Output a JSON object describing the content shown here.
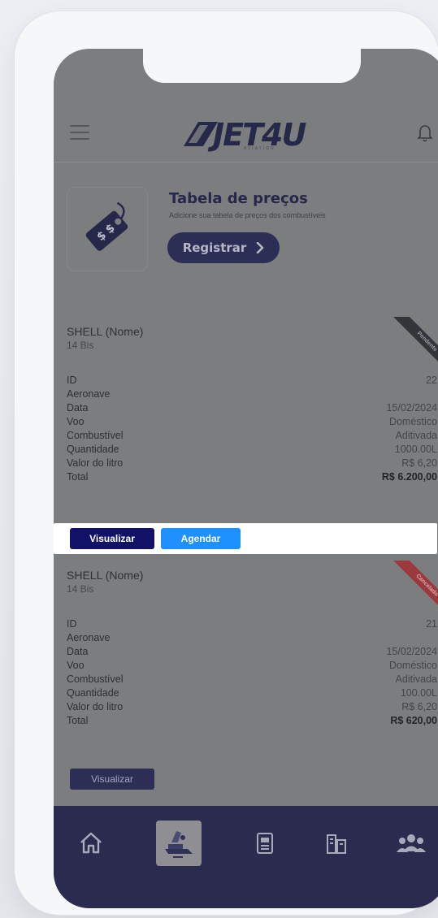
{
  "app": {
    "logo_text": "JET4U",
    "logo_subtitle": "AVIATION"
  },
  "header": {
    "menu_icon": "hamburger-icon",
    "notification_icon": "bell-icon"
  },
  "promo": {
    "title": "Tabela de preços",
    "subtitle": "Adicione sua tabela de preços dos combustíveis",
    "button_label": "Registrar",
    "icon": "price-tag-icon"
  },
  "cards": [
    {
      "name": "SHELL (Nome)",
      "sub": "14 Bis",
      "ribbon": "Pendente",
      "fields": [
        {
          "label": "ID",
          "value": "22"
        },
        {
          "label": "Aeronave",
          "value": ""
        },
        {
          "label": "Data",
          "value": "15/02/2024"
        },
        {
          "label": "Voo",
          "value": "Doméstico"
        },
        {
          "label": "Combustível",
          "value": "Aditivada"
        },
        {
          "label": "Quantidade",
          "value": "1000.00L"
        },
        {
          "label": "Valor do litro",
          "value": "R$ 6,20"
        },
        {
          "label": "Total",
          "value": "R$ 6.200,00"
        }
      ],
      "actions": {
        "view": "Visualizar",
        "schedule": "Agendar"
      }
    },
    {
      "name": "SHELL (Nome)",
      "sub": "14 Bis",
      "ribbon": "Cancelado",
      "fields": [
        {
          "label": "ID",
          "value": "21"
        },
        {
          "label": "Aeronave",
          "value": ""
        },
        {
          "label": "Data",
          "value": "15/02/2024"
        },
        {
          "label": "Voo",
          "value": "Doméstico"
        },
        {
          "label": "Combustível",
          "value": "Aditivada"
        },
        {
          "label": "Quantidade",
          "value": "100.00L"
        },
        {
          "label": "Valor do litro",
          "value": "R$ 6,20"
        },
        {
          "label": "Total",
          "value": "R$ 620,00"
        }
      ],
      "actions": {
        "view": "Visualizar"
      }
    }
  ],
  "tabbar": {
    "items": [
      {
        "icon": "home-icon",
        "active": false
      },
      {
        "icon": "fuel-truck-icon",
        "active": true
      },
      {
        "icon": "document-icon",
        "active": false
      },
      {
        "icon": "buildings-icon",
        "active": false
      },
      {
        "icon": "users-icon",
        "active": false
      }
    ]
  },
  "colors": {
    "primary": "#2a2b4e",
    "primary_button": "#111267",
    "secondary_button": "#1e90ff",
    "cancel_ribbon": "#b03a3a",
    "pending_ribbon": "#3a3b42",
    "screen_overlay": "#7c7d7f"
  }
}
